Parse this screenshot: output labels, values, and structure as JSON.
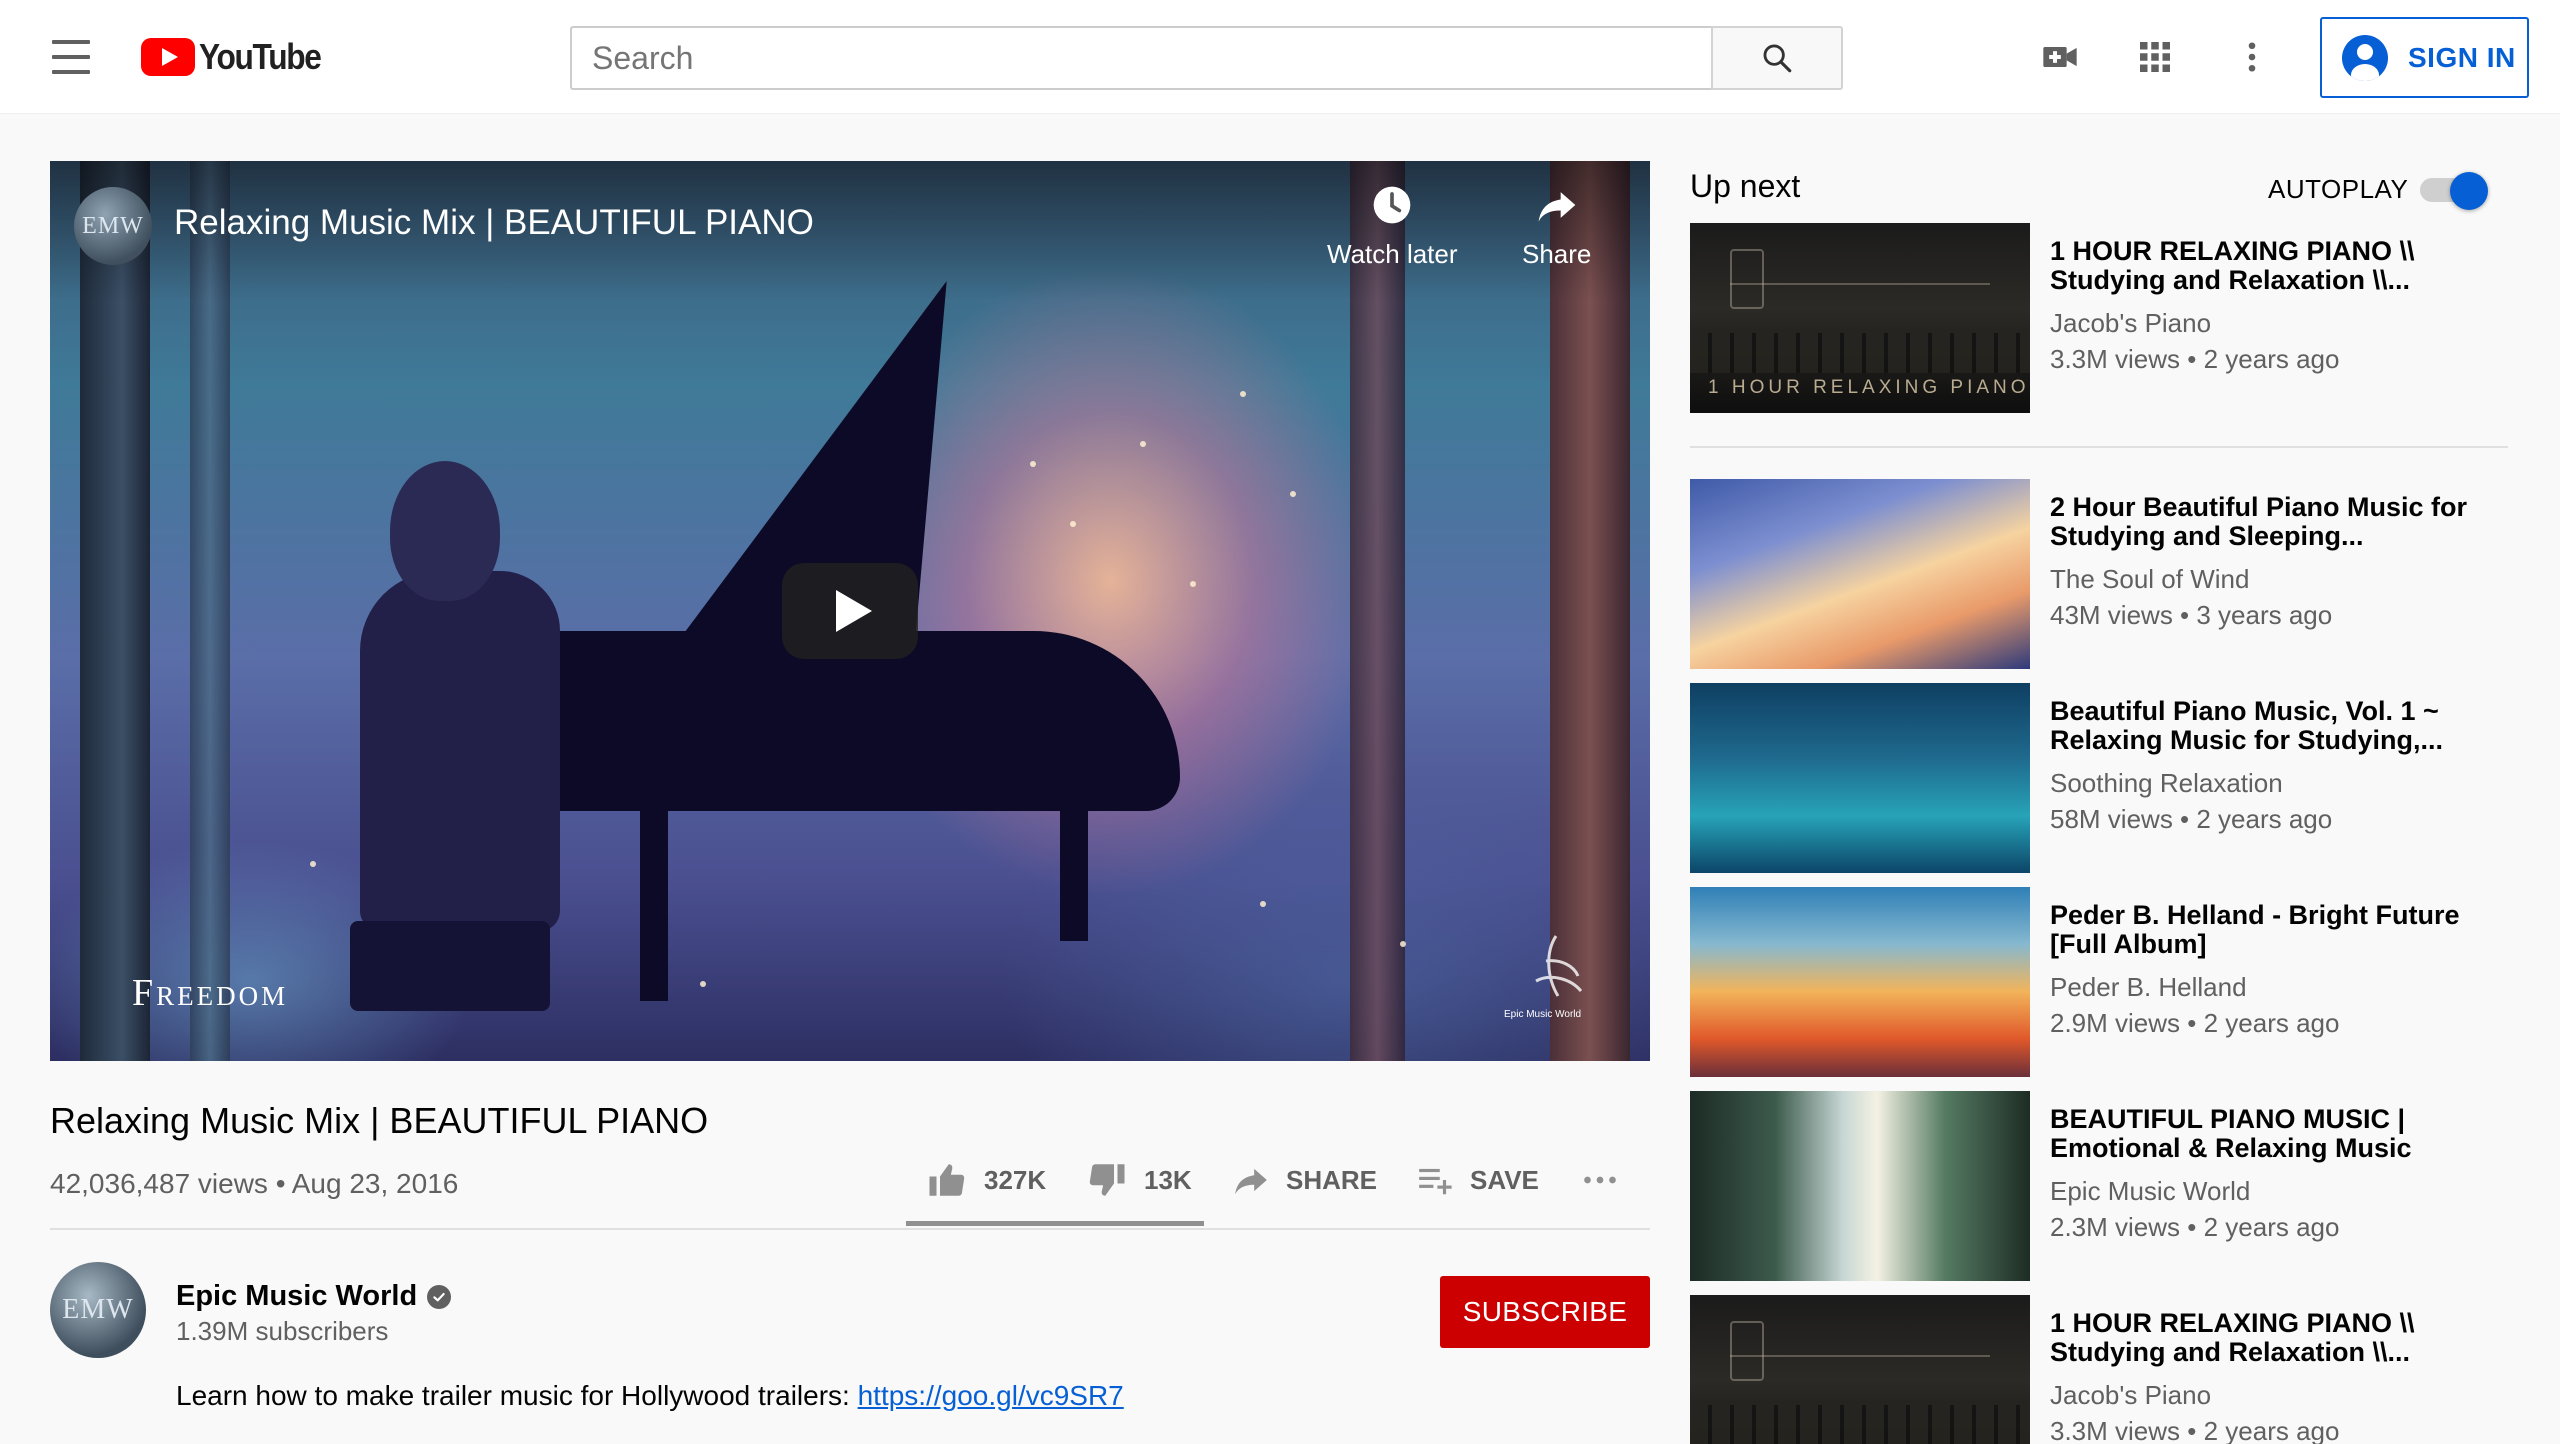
{
  "header": {
    "logo_text": "YouTube",
    "search_placeholder": "Search",
    "sign_in_label": "SIGN IN",
    "icons": [
      "menu-icon",
      "youtube-logo",
      "search-icon",
      "create-video-icon",
      "apps-grid-icon",
      "more-vert-icon",
      "account-circle-icon"
    ]
  },
  "player": {
    "overlay_title": "Relaxing Music Mix | BEAUTIFUL PIANO",
    "channel_badge": "EMW",
    "watch_later_label": "Watch later",
    "share_label": "Share",
    "frame_caption": "Freedom",
    "watermark_text": "Epic Music World"
  },
  "video": {
    "title": "Relaxing Music Mix | BEAUTIFUL PIANO",
    "meta": "42,036,487 views • Aug 23, 2016",
    "likes": "327K",
    "dislikes": "13K",
    "share_label": "SHARE",
    "save_label": "SAVE",
    "like_ratio": 0.96
  },
  "owner": {
    "avatar_text": "EMW",
    "name": "Epic Music World",
    "subscribers": "1.39M subscribers",
    "subscribe_label": "SUBSCRIBE",
    "description_text": "Learn how to make trailer music for Hollywood trailers: ",
    "description_link": "https://goo.gl/vc9SR7"
  },
  "upnext": {
    "title": "Up next",
    "autoplay_label": "AUTOPLAY",
    "autoplay_on": true,
    "items": [
      {
        "title": "1 HOUR RELAXING PIANO \\\\ Studying and Relaxation \\\\...",
        "channel": "Jacob's Piano",
        "meta": "3.3M views • 2 years ago",
        "thumb_text": "1 HOUR RELAXING PIANO"
      },
      {
        "title": "2 Hour Beautiful Piano Music for Studying and Sleeping...",
        "channel": "The Soul of Wind",
        "meta": "43M views • 3 years ago"
      },
      {
        "title": "Beautiful Piano Music, Vol. 1 ~ Relaxing Music for Studying,...",
        "channel": "Soothing Relaxation",
        "meta": "58M views • 2 years ago"
      },
      {
        "title": "Peder B. Helland - Bright Future [Full Album]",
        "channel": "Peder B. Helland",
        "meta": "2.9M views • 2 years ago"
      },
      {
        "title": "BEAUTIFUL PIANO MUSIC | Emotional & Relaxing Music",
        "channel": "Epic Music World",
        "meta": "2.3M views • 2 years ago"
      },
      {
        "title": "1 HOUR RELAXING PIANO \\\\ Studying and Relaxation \\\\...",
        "channel": "Jacob's Piano",
        "meta": "3.3M views • 2 years ago"
      }
    ]
  },
  "colors": {
    "brand_red": "#ff0000",
    "subscribe_red": "#cc0000",
    "link_blue": "#065fd4",
    "secondary_text": "#606060"
  }
}
